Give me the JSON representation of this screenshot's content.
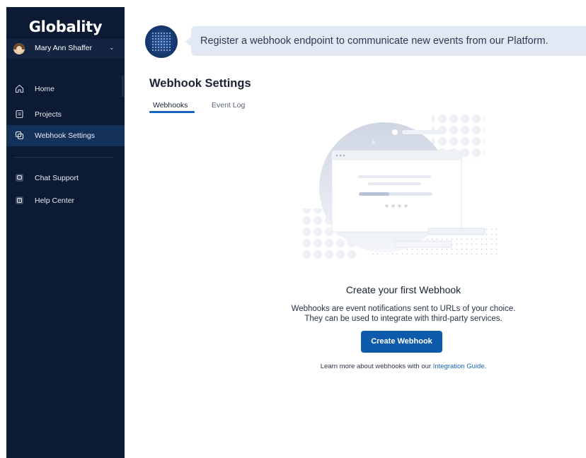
{
  "app": {
    "logo": "Globality"
  },
  "user": {
    "name": "Mary Ann Shaffer"
  },
  "sidebar": {
    "items": [
      {
        "label": "Home",
        "icon": "home-icon"
      },
      {
        "label": "Projects",
        "icon": "projects-icon"
      },
      {
        "label": "Webhook Settings",
        "icon": "webhook-icon",
        "active": true
      }
    ],
    "support_items": [
      {
        "label": "Chat Support",
        "icon": "chat-icon"
      },
      {
        "label": "Help Center",
        "icon": "help-icon"
      }
    ]
  },
  "banner": {
    "text": "Register a webhook endpoint to communicate new events from our Platform."
  },
  "page": {
    "title": "Webhook Settings"
  },
  "tabs": [
    {
      "label": "Webhooks",
      "active": true
    },
    {
      "label": "Event Log",
      "active": false
    }
  ],
  "empty_state": {
    "illustration_text": "* * * *",
    "title": "Create your first Webhook",
    "description_line1": "Webhooks are event notifications sent to URLs of your choice.",
    "description_line2": "They can be used to integrate with third-party services.",
    "button_label": "Create Webhook",
    "learn_prefix": "Learn more about webhooks with our ",
    "learn_link": "Integration Guide",
    "learn_suffix": "."
  },
  "colors": {
    "sidebar_bg": "#0d1a33",
    "sidebar_active": "#143259",
    "accent": "#0f5bab",
    "link": "#1565c0",
    "banner_bg": "#e3e9f4"
  }
}
